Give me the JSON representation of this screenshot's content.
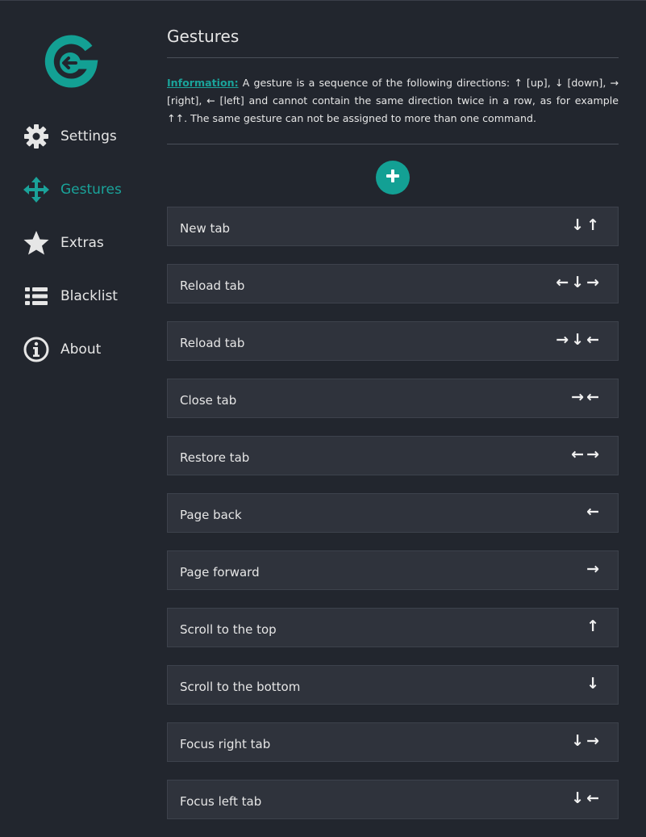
{
  "sidebar": {
    "logo_icon": "g-logo-icon",
    "accent_color": "#1aa39a",
    "items": [
      {
        "label": "Settings",
        "icon": "gear-icon",
        "active": false
      },
      {
        "label": "Gestures",
        "icon": "move-arrows-icon",
        "active": true
      },
      {
        "label": "Extras",
        "icon": "star-icon",
        "active": false
      },
      {
        "label": "Blacklist",
        "icon": "list-icon",
        "active": false
      },
      {
        "label": "About",
        "icon": "info-icon",
        "active": false
      }
    ]
  },
  "main": {
    "title": "Gestures",
    "info_label": "Information:",
    "info_text": " A gesture is a sequence of the following directions: ↑ [up], ↓ [down], → [right], ← [left] and cannot contain the same direction twice in a row, as for example ↑↑. The same gesture can not be assigned to more than one command.",
    "add_button_icon": "plus-icon",
    "gestures": [
      {
        "command": "New tab",
        "gesture": "↓↑"
      },
      {
        "command": "Reload tab",
        "gesture": "←↓→"
      },
      {
        "command": "Reload tab",
        "gesture": "→↓←"
      },
      {
        "command": "Close tab",
        "gesture": "→←"
      },
      {
        "command": "Restore tab",
        "gesture": "←→"
      },
      {
        "command": "Page back",
        "gesture": "←"
      },
      {
        "command": "Page forward",
        "gesture": "→"
      },
      {
        "command": "Scroll to the top",
        "gesture": "↑"
      },
      {
        "command": "Scroll to the bottom",
        "gesture": "↓"
      },
      {
        "command": "Focus right tab",
        "gesture": "↓→"
      },
      {
        "command": "Focus left tab",
        "gesture": "↓←"
      }
    ]
  }
}
